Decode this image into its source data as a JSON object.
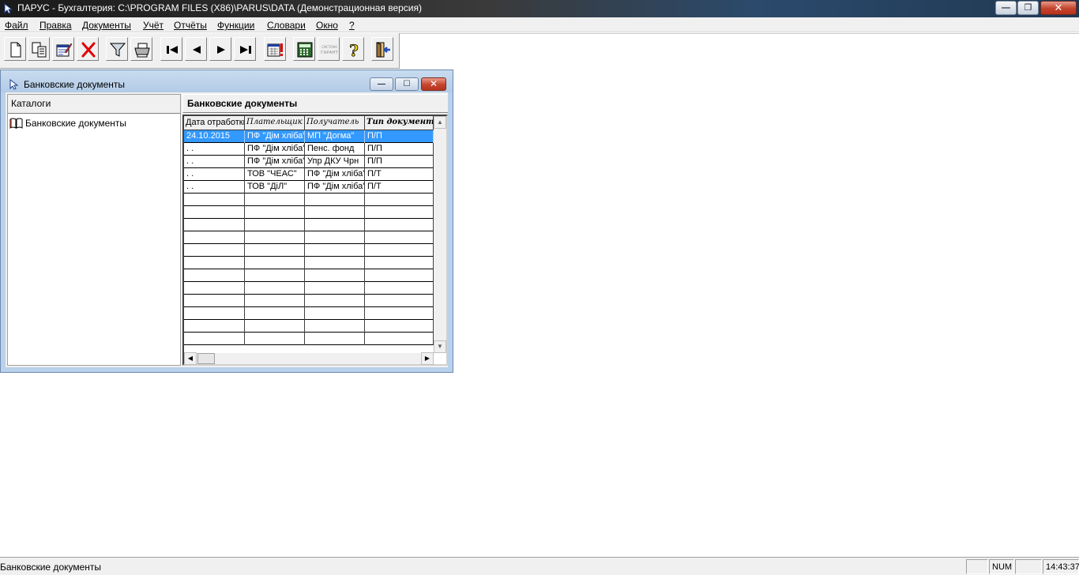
{
  "app": {
    "title": "ПАРУС - Бухгалтерия: C:\\PROGRAM FILES (X86)\\PARUS\\DATA (Демонстрационная версия)"
  },
  "menu": [
    {
      "label": "Файл"
    },
    {
      "label": "Правка"
    },
    {
      "label": "Документы"
    },
    {
      "label": "Учёт"
    },
    {
      "label": "Отчёты"
    },
    {
      "label": "Функции"
    },
    {
      "label": "Словари"
    },
    {
      "label": "Окно"
    },
    {
      "label": "?"
    }
  ],
  "toolbar": {
    "buttons": [
      {
        "icon": "new-document-icon"
      },
      {
        "icon": "copy-icon"
      },
      {
        "icon": "edit-icon"
      },
      {
        "icon": "delete-icon"
      },
      {
        "icon": "filter-icon"
      },
      {
        "icon": "print-icon"
      },
      {
        "icon": "first-record-icon"
      },
      {
        "icon": "previous-record-icon"
      },
      {
        "icon": "next-record-icon"
      },
      {
        "icon": "last-record-icon"
      },
      {
        "icon": "calendar-alert-icon"
      },
      {
        "icon": "calculator-icon"
      },
      {
        "icon": "garant-system-icon",
        "text": "СИСТЕМА ГАРАНТ"
      },
      {
        "icon": "help-icon"
      },
      {
        "icon": "exit-icon"
      }
    ]
  },
  "child_window": {
    "title": "Банковские документы",
    "catalog_header": "Каталоги",
    "catalog_item": "Банковские документы",
    "grid_caption": "Банковские документы",
    "columns": [
      {
        "label": "Дата отработки"
      },
      {
        "label": "Плательщик"
      },
      {
        "label": "Получатель"
      },
      {
        "label": "Тип документа"
      }
    ],
    "rows": [
      {
        "date": "24.10.2015",
        "payer": "ПФ \"Дім хліба\"",
        "receiver": "МП \"Догма\"",
        "doc_type": "П/П",
        "selected": true
      },
      {
        "date": "  .  .",
        "payer": "ПФ \"Дім хліба\"",
        "receiver": "Пенс. фонд",
        "doc_type": "П/П"
      },
      {
        "date": "  .  .",
        "payer": "ПФ \"Дім хліба\"",
        "receiver": "Упр ДКУ Чрн",
        "doc_type": "П/П"
      },
      {
        "date": "  .  .",
        "payer": "ТОВ \"ЧЕАС\"",
        "receiver": "ПФ \"Дім хліба\"",
        "doc_type": "П/Т"
      },
      {
        "date": "  .  .",
        "payer": "ТОВ \"ДіЛ\"",
        "receiver": "ПФ \"Дім хліба\"",
        "doc_type": "П/Т"
      }
    ]
  },
  "status": {
    "text": "Банковские документы",
    "num": "NUM",
    "time": "14:43:37"
  },
  "colors": {
    "selection": "#3399ff",
    "title_gradient_end": "#2b4a6c",
    "child_frame": "#b9d1ea",
    "close_button": "#c4432b"
  }
}
